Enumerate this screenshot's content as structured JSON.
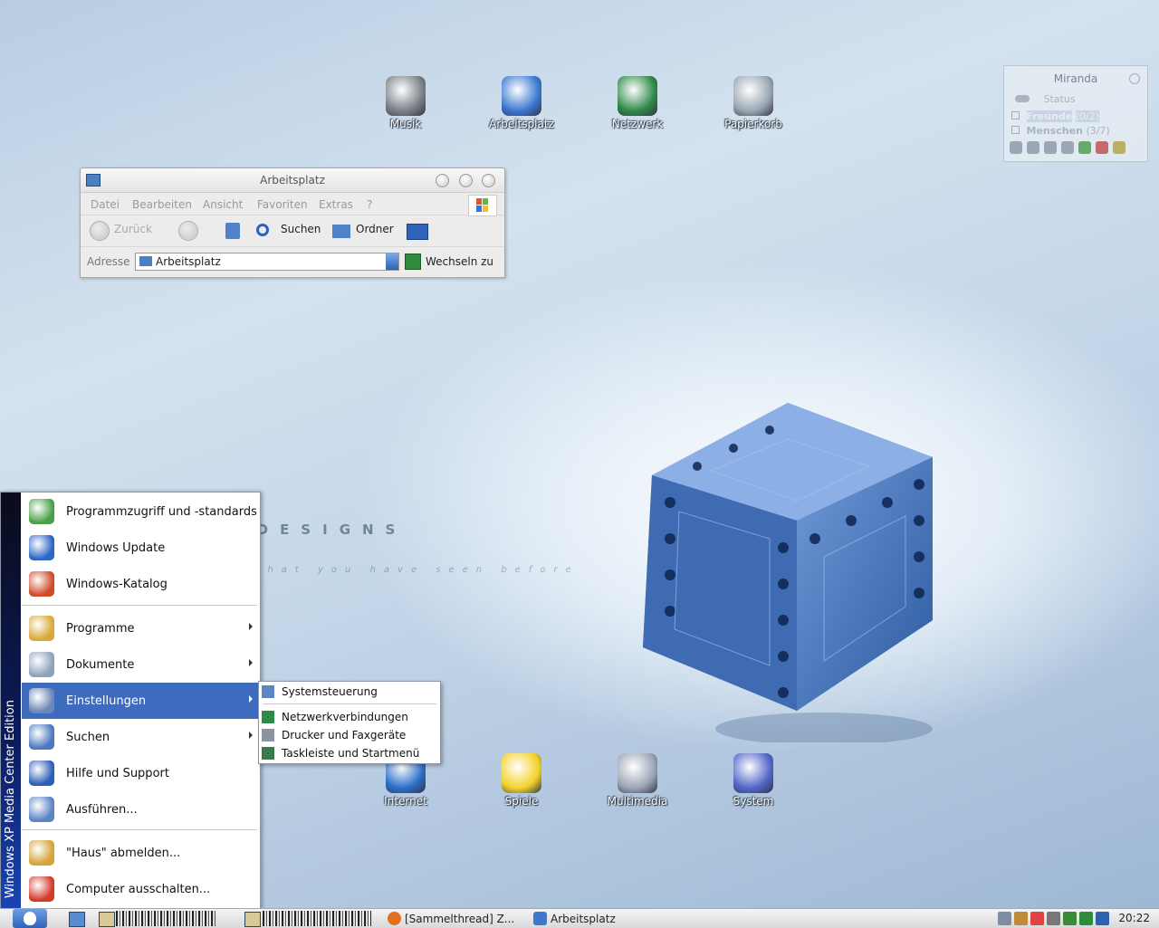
{
  "desktop": {
    "icons_top": [
      {
        "label": "Musik",
        "color": "#7a8088"
      },
      {
        "label": "Arbeitsplatz",
        "color": "#3b78d0"
      },
      {
        "label": "Netzwerk",
        "color": "#2f8a4a"
      },
      {
        "label": "Papierkorb",
        "color": "#9aa6b4"
      }
    ],
    "icons_bottom": [
      {
        "label": "Internet",
        "color": "#2a6fc7"
      },
      {
        "label": "Spiele",
        "color": "#f2d22a"
      },
      {
        "label": "Multimedia",
        "color": "#9aa6b4"
      },
      {
        "label": "System",
        "color": "#5266c9"
      }
    ],
    "watermark_title": "ASCELLA DESIGNS",
    "watermark_tagline": "not quite what you have seen before"
  },
  "explorer": {
    "title": "Arbeitsplatz",
    "menu": [
      "Datei",
      "Bearbeiten",
      "Ansicht",
      "Favoriten",
      "Extras",
      "?"
    ],
    "toolbar": {
      "back": "Zurück",
      "search": "Suchen",
      "folders": "Ordner"
    },
    "address_label": "Adresse",
    "address_value": "Arbeitsplatz",
    "go_label": "Wechseln zu"
  },
  "miranda": {
    "title": "Miranda",
    "status": "Status",
    "groups": [
      {
        "name": "Freunde",
        "count": "(0/2)"
      },
      {
        "name": "Menschen",
        "count": "(3/7)"
      }
    ]
  },
  "startmenu": {
    "edition": "Windows XP Media Center Edition",
    "top_items": [
      {
        "label": "Programmzugriff und -standards",
        "icon": "program-access-icon",
        "color": "#4aa04a"
      },
      {
        "label": "Windows Update",
        "icon": "windows-update-icon",
        "color": "#2b67c6"
      },
      {
        "label": "Windows-Katalog",
        "icon": "windows-catalog-icon",
        "color": "#d14a2a"
      }
    ],
    "main_items": [
      {
        "label": "Programme",
        "icon": "programs-icon",
        "color": "#d9a83a",
        "submenu": true
      },
      {
        "label": "Dokumente",
        "icon": "documents-icon",
        "color": "#8fa2bd",
        "submenu": true
      },
      {
        "label": "Einstellungen",
        "icon": "settings-icon",
        "color": "#6b86b8",
        "submenu": true,
        "active": true
      },
      {
        "label": "Suchen",
        "icon": "search-icon",
        "color": "#4d79c0",
        "submenu": true
      },
      {
        "label": "Hilfe und Support",
        "icon": "help-icon",
        "color": "#2e5fb8",
        "submenu": false
      },
      {
        "label": "Ausführen...",
        "icon": "run-icon",
        "color": "#5b83c4",
        "submenu": false
      }
    ],
    "bottom_items": [
      {
        "label": "\"Haus\" abmelden...",
        "icon": "logoff-icon",
        "color": "#d4a33a"
      },
      {
        "label": "Computer ausschalten...",
        "icon": "shutdown-icon",
        "color": "#d23a2a"
      }
    ]
  },
  "submenu": {
    "items": [
      {
        "label": "Systemsteuerung",
        "icon": "control-panel-icon",
        "color": "#5f86c4"
      },
      {
        "label": "Netzwerkverbindungen",
        "icon": "network-connections-icon",
        "color": "#2f8a4a"
      },
      {
        "label": "Drucker und Faxgeräte",
        "icon": "printer-icon",
        "color": "#8a94a2"
      },
      {
        "label": "Taskleiste und Startmenü",
        "icon": "taskbar-icon",
        "color": "#3a7a4a"
      }
    ]
  },
  "taskbar": {
    "tasks": [
      {
        "label": "[Sammelthread] Z...",
        "icon": "firefox-icon",
        "color": "#e0701c"
      },
      {
        "label": "Arbeitsplatz",
        "icon": "my-computer-icon",
        "color": "#3b78d0"
      }
    ],
    "clock": "20:22"
  }
}
